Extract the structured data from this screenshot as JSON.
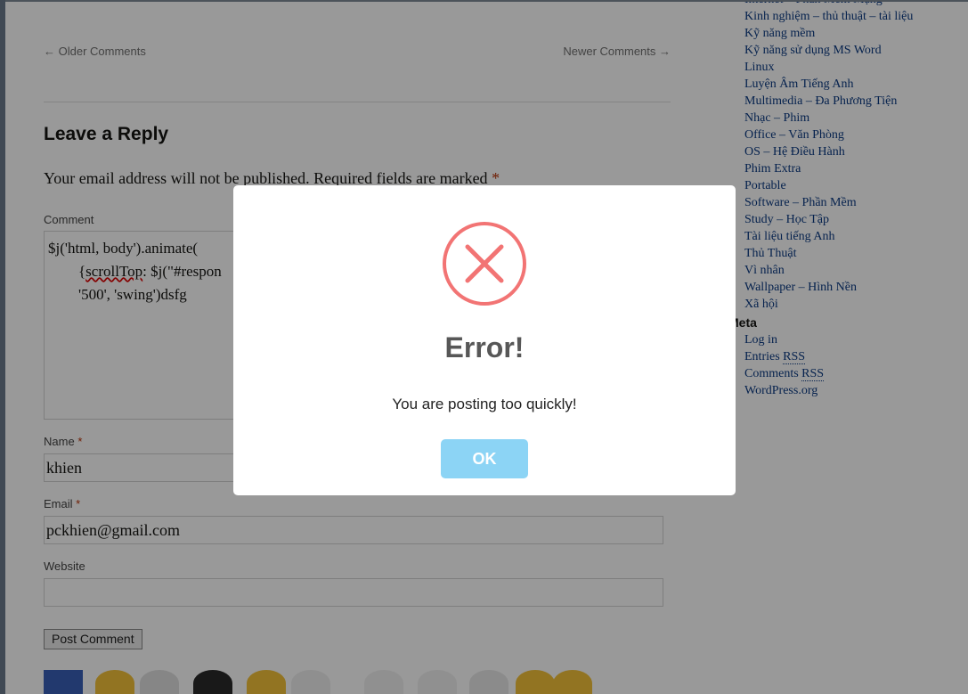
{
  "comment_nav": {
    "older": "← Older Comments",
    "newer": "Newer Comments →"
  },
  "reply": {
    "title": "Leave a Reply",
    "notes": "Your email address will not be published. Required fields are marked",
    "required_mark": "*"
  },
  "form": {
    "comment_label": "Comment",
    "comment_value_line1": "$j('html, body').animate(",
    "comment_value_line2_prefix": "        {",
    "comment_value_line2_word": "scrollTop",
    "comment_value_line2_suffix": ": $j(\"#respon",
    "comment_value_line3": "        '500', 'swing')dsfg",
    "name_label": "Name",
    "name_value": "khien",
    "email_label": "Email",
    "email_value": "pckhien@gmail.com",
    "website_label": "Website",
    "website_value": "",
    "submit_label": "Post Comment"
  },
  "sidebar": {
    "categories": [
      "Internet – Phần Mềm Mạng",
      "Kinh nghiệm – thủ thuật – tài liệu",
      "Kỹ năng mềm",
      "Kỹ năng sử dụng MS Word",
      "Linux",
      "Luyện Âm Tiếng Anh",
      "Multimedia – Đa Phương Tiện",
      "Nhạc – Phim",
      "Office – Văn Phòng",
      "OS – Hệ Điều Hành",
      "Phim Extra",
      "Portable",
      "Software – Phần Mềm",
      "Study – Học Tập",
      "Tài liệu tiếng Anh",
      "Thủ Thuật",
      "Vì nhân",
      "Wallpaper – Hình Nền",
      "Xã hội"
    ],
    "meta_title": "Meta",
    "meta": {
      "login": "Log in",
      "entries_prefix": "Entries",
      "comments_prefix": "Comments",
      "rss": "RSS",
      "wordpress": "WordPress.org"
    }
  },
  "dialog": {
    "title": "Error!",
    "message": "You are posting too quickly!",
    "ok_label": "OK"
  },
  "colors": {
    "error_red": "#f27474",
    "ok_blue": "#8cd4f5",
    "link_blue": "#0b3a82"
  }
}
